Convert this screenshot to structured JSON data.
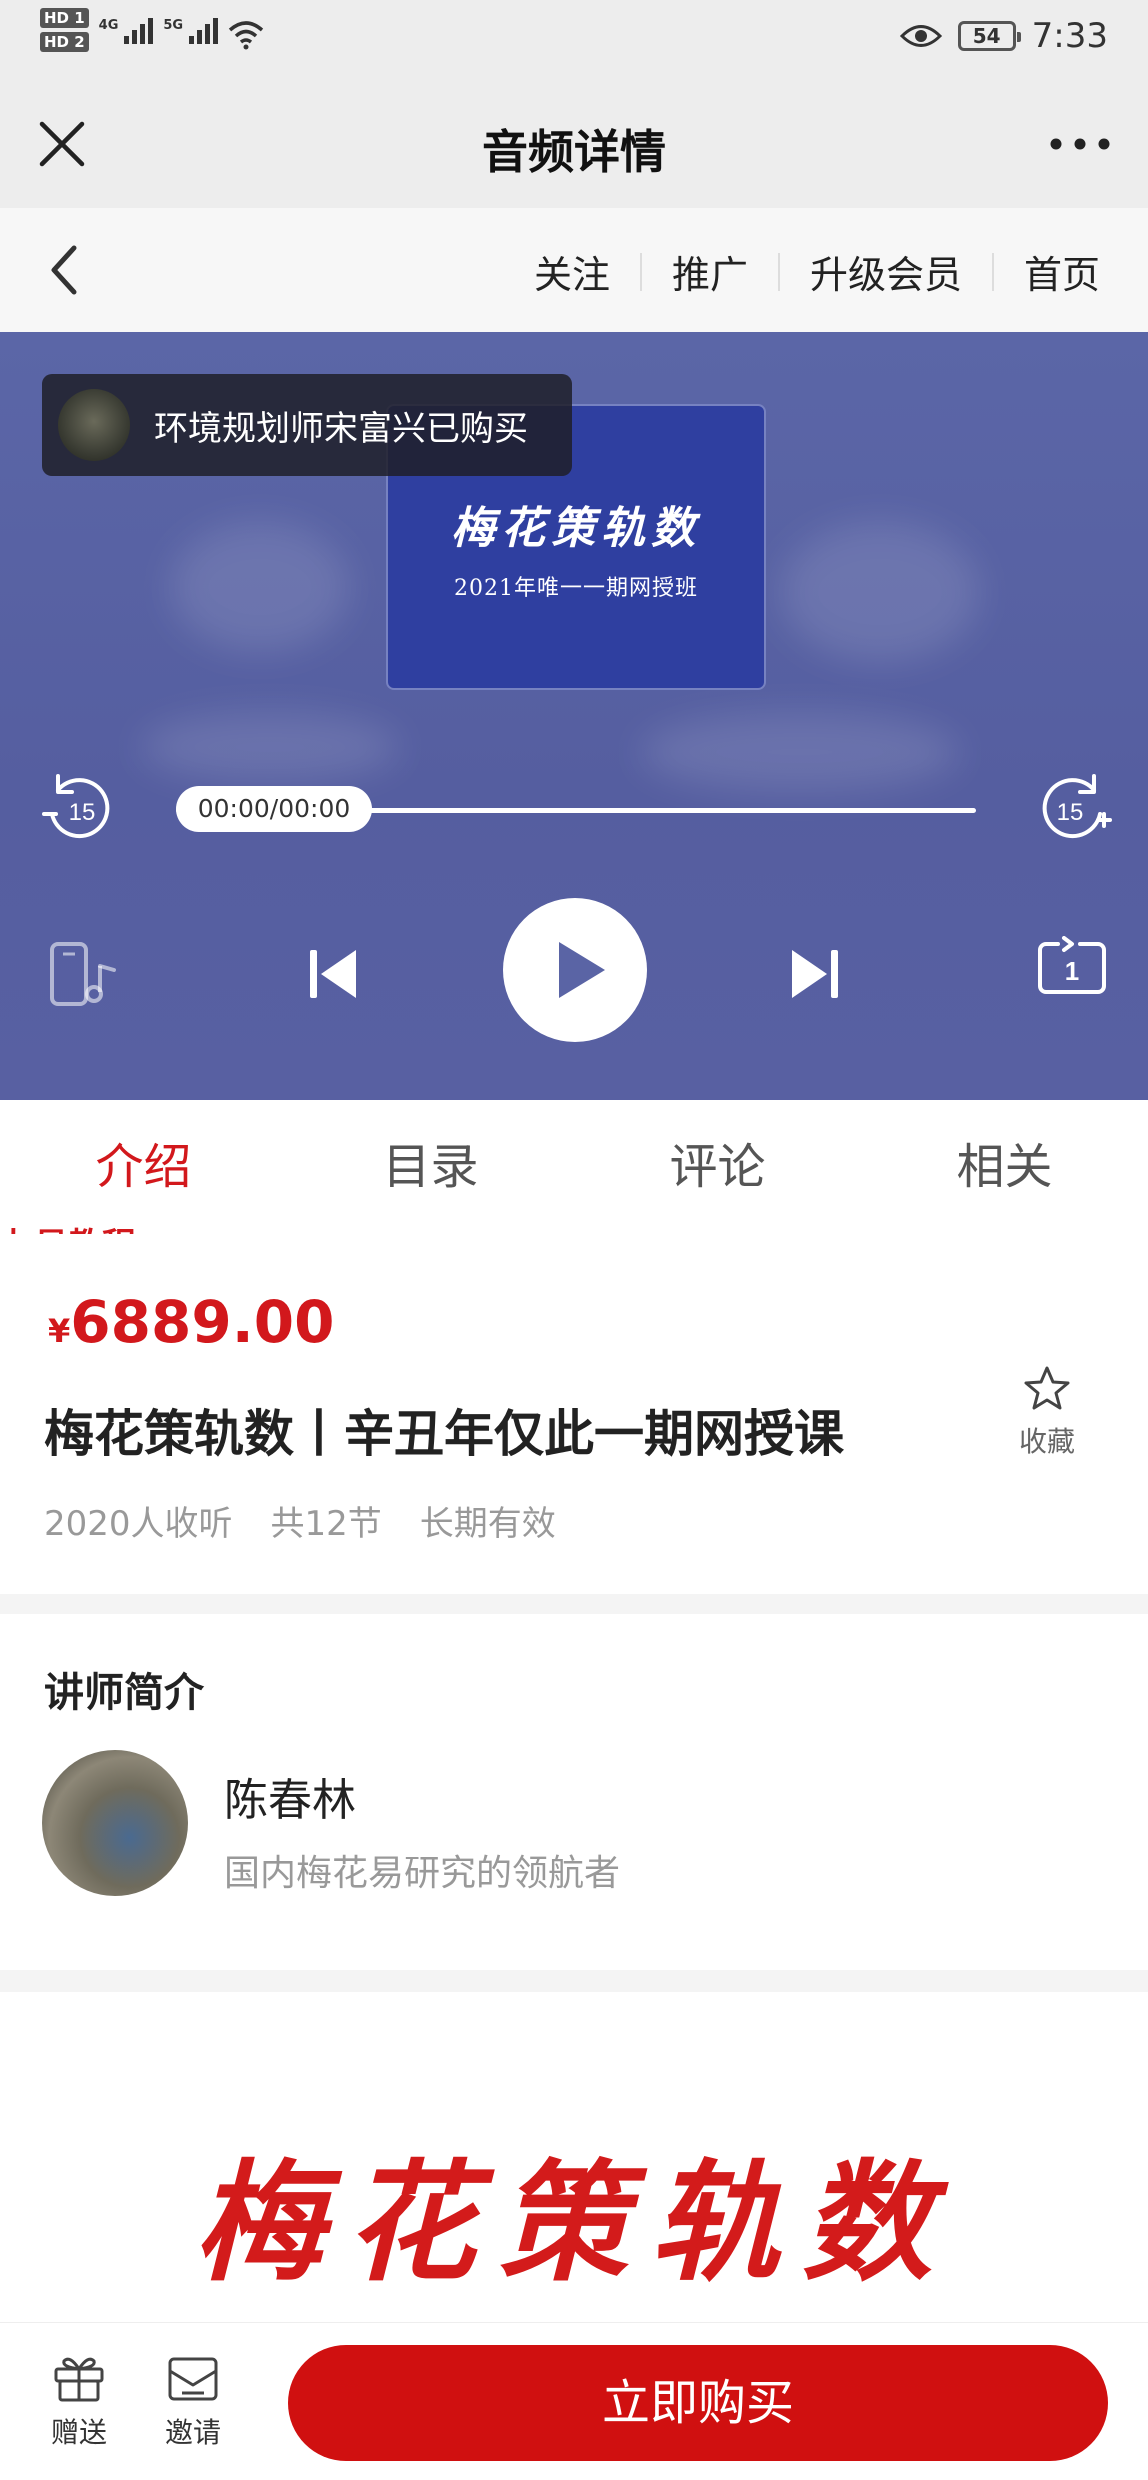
{
  "status_bar": {
    "sim1": "HD 1",
    "sim2": "HD 2",
    "network1": "4G",
    "network2": "5G",
    "battery": "54",
    "time": "7:33",
    "icons": [
      "signal-icon",
      "wifi-icon",
      "eye-icon",
      "battery-icon"
    ]
  },
  "titlebar": {
    "title": "音频详情"
  },
  "subnav": {
    "links": [
      "关注",
      "推广",
      "升级会员",
      "首页"
    ]
  },
  "player": {
    "toast": "环境规划师宋富兴已购买",
    "cover_title": "梅花策轨数",
    "cover_subtitle": "2021年唯一一期网授班",
    "time": "00:00/00:00",
    "rewind_label": "15",
    "forward_label": "15",
    "speed_label": "1",
    "progress": 0
  },
  "tabs": [
    "介绍",
    "目录",
    "评论",
    "相关"
  ],
  "watermark": "九易教程",
  "course": {
    "currency": "¥",
    "price": "6889.00",
    "title": "梅花策轨数丨辛丑年仅此一期网授课",
    "listeners": "2020人收听",
    "lessons": "共12节",
    "validity": "长期有效",
    "favorite": "收藏"
  },
  "teacher": {
    "heading": "讲师简介",
    "name": "陈春林",
    "description": "国内梅花易研究的领航者"
  },
  "banner": {
    "text": "梅花策轨数"
  },
  "bottom": {
    "gift": "赠送",
    "invite": "邀请",
    "buy": "立即购买"
  },
  "colors": {
    "accent": "#d2181c",
    "player_bg": "#5a64a5",
    "cover_bg": "#2f3fa0"
  }
}
